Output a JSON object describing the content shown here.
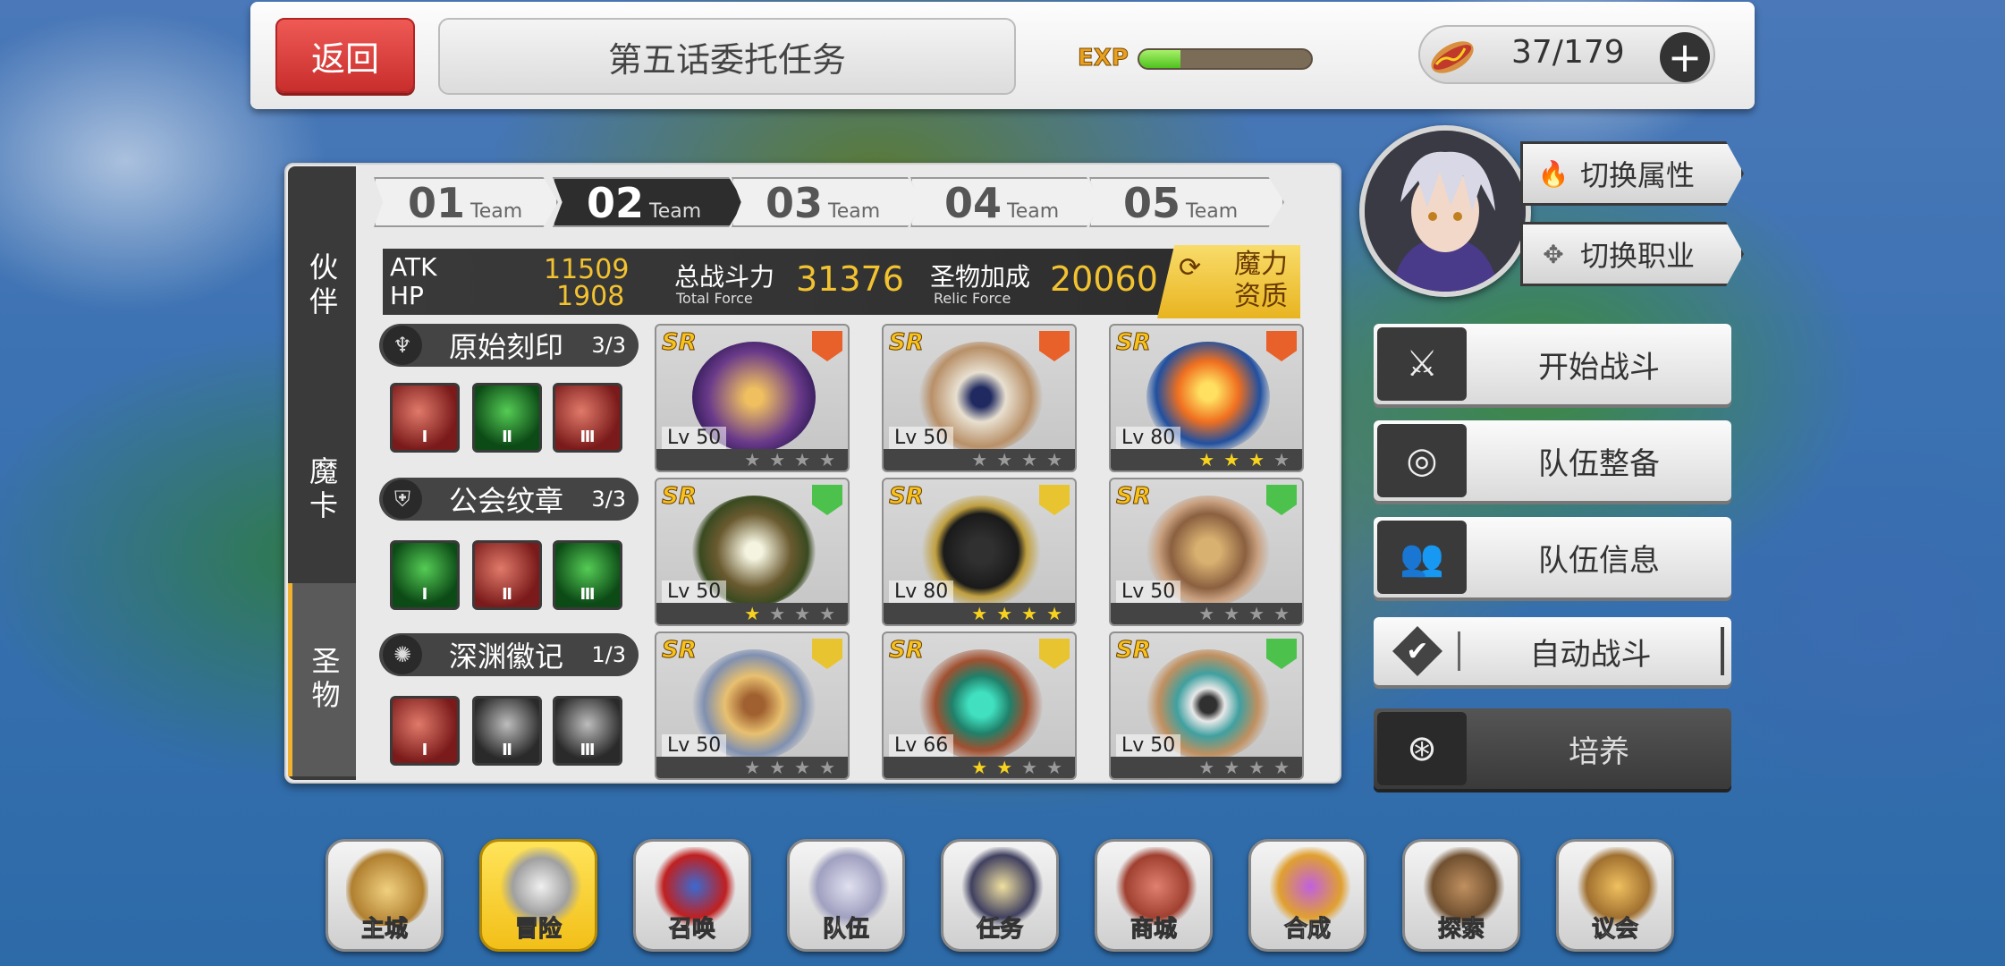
{
  "header": {
    "back_label": "返回",
    "title": "第五话委托任务",
    "exp_label": "EXP",
    "exp_progress": 0.24,
    "stamina_value": "37/179",
    "plus_label": "+"
  },
  "side_tabs": [
    {
      "label": "伙伴"
    },
    {
      "label": "魔卡"
    },
    {
      "label": "圣物"
    }
  ],
  "team_tabs": [
    {
      "num": "01",
      "word": "Team"
    },
    {
      "num": "02",
      "word": "Team"
    },
    {
      "num": "03",
      "word": "Team"
    },
    {
      "num": "04",
      "word": "Team"
    },
    {
      "num": "05",
      "word": "Team"
    }
  ],
  "stats": {
    "atk_label": "ATK",
    "atk_value": "11509",
    "hp_label": "HP",
    "hp_value": "1908",
    "total_force_label": "总战斗力",
    "total_force_sub": "Total Force",
    "total_force_value": "31376",
    "relic_force_label": "圣物加成",
    "relic_force_sub": "Relic Force",
    "relic_force_value": "20060",
    "mana_label_1": "魔力",
    "mana_label_2": "资质"
  },
  "relic_sets": [
    {
      "name": "原始刻印",
      "count": "3/3",
      "gems": [
        {
          "color": "red",
          "numeral": "Ⅰ"
        },
        {
          "color": "green",
          "numeral": "Ⅱ"
        },
        {
          "color": "red",
          "numeral": "Ⅲ"
        }
      ]
    },
    {
      "name": "公会纹章",
      "count": "3/3",
      "gems": [
        {
          "color": "green",
          "numeral": "Ⅰ"
        },
        {
          "color": "red",
          "numeral": "Ⅱ"
        },
        {
          "color": "green",
          "numeral": "Ⅲ"
        }
      ]
    },
    {
      "name": "深渊徽记",
      "count": "1/3",
      "gems": [
        {
          "color": "red",
          "numeral": "Ⅰ"
        },
        {
          "color": "gray",
          "numeral": "Ⅱ"
        },
        {
          "color": "gray",
          "numeral": "Ⅲ"
        }
      ]
    }
  ],
  "relic_cards": [
    {
      "rarity": "SR",
      "level": "Lv 50",
      "stars": 0,
      "element": "fire"
    },
    {
      "rarity": "SR",
      "level": "Lv 50",
      "stars": 0,
      "element": "fire"
    },
    {
      "rarity": "SR",
      "level": "Lv 80",
      "stars": 3,
      "element": "fire"
    },
    {
      "rarity": "SR",
      "level": "Lv 50",
      "stars": 1,
      "element": "wind"
    },
    {
      "rarity": "SR",
      "level": "Lv 80",
      "stars": 4,
      "element": "light"
    },
    {
      "rarity": "SR",
      "level": "Lv 50",
      "stars": 0,
      "element": "wind"
    },
    {
      "rarity": "SR",
      "level": "Lv 50",
      "stars": 0,
      "element": "light"
    },
    {
      "rarity": "SR",
      "level": "Lv 66",
      "stars": 2,
      "element": "light"
    },
    {
      "rarity": "SR",
      "level": "Lv 50",
      "stars": 0,
      "element": "wind"
    }
  ],
  "hero": {
    "switch_attribute_label": "切换属性",
    "switch_class_label": "切换职业"
  },
  "actions": {
    "start_battle": "开始战斗",
    "team_prep": "队伍整备",
    "team_info": "队伍信息",
    "auto_battle": "自动战斗",
    "cultivate": "培养"
  },
  "bottom_nav": [
    {
      "label": "主城"
    },
    {
      "label": "冒险"
    },
    {
      "label": "召唤"
    },
    {
      "label": "队伍"
    },
    {
      "label": "任务"
    },
    {
      "label": "商城"
    },
    {
      "label": "合成"
    },
    {
      "label": "探索"
    },
    {
      "label": "议会"
    }
  ],
  "colors": {
    "accent_red": "#d8403d",
    "gold": "#f2c230",
    "active_nav": "#f5c820",
    "fire": "#e8602a",
    "wind": "#4cc24c",
    "light": "#e8c430"
  }
}
